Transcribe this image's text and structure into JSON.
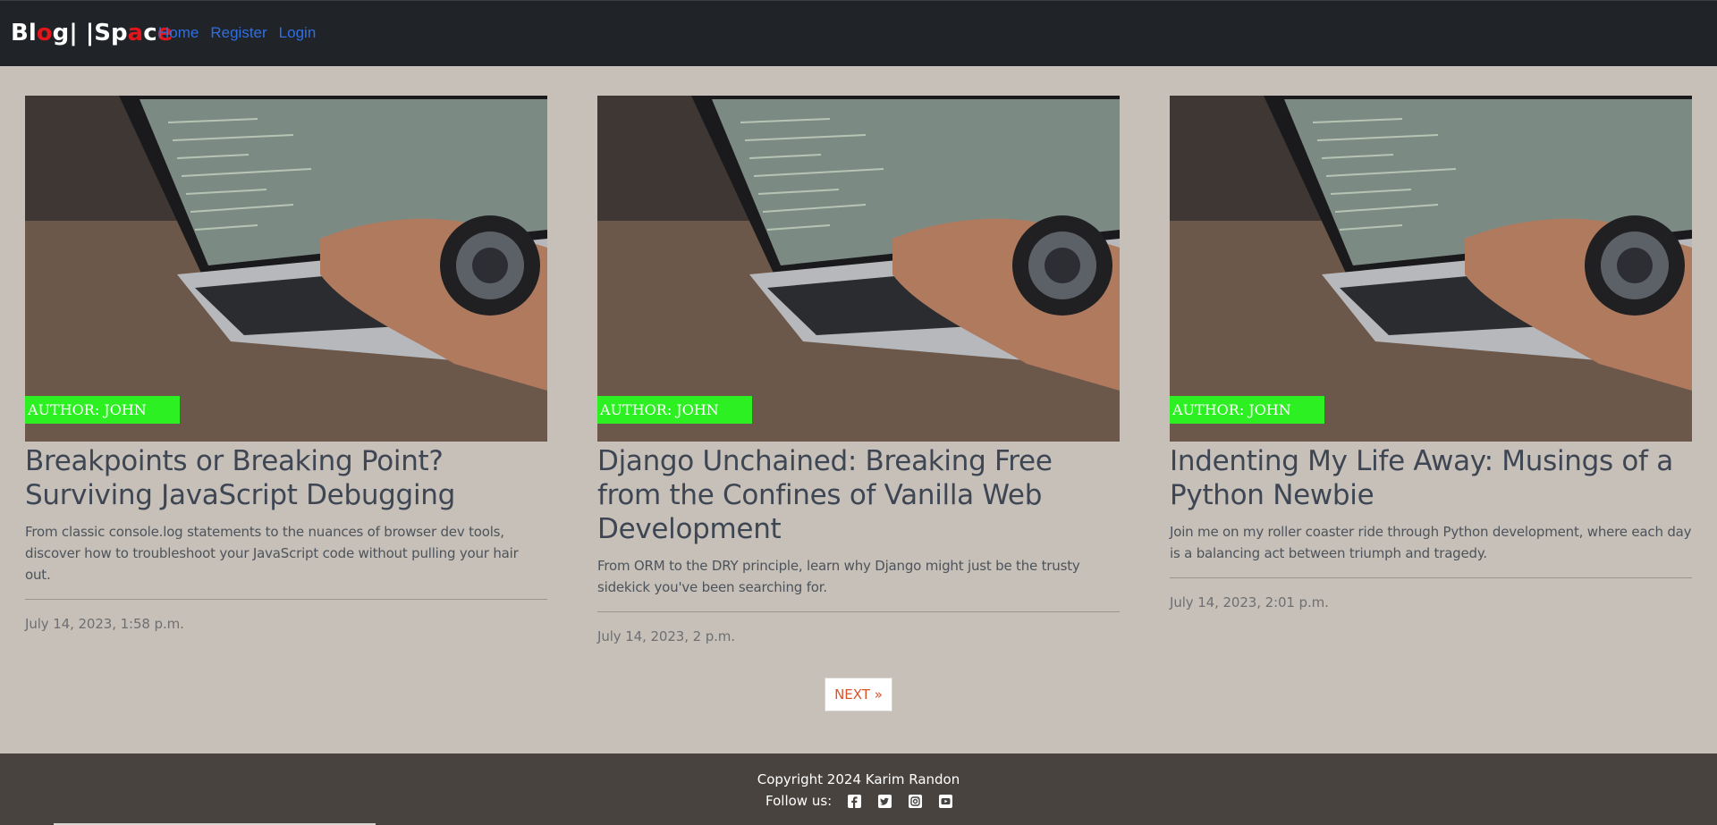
{
  "nav": {
    "brand_parts": [
      {
        "text": "Bl",
        "red": false
      },
      {
        "text": "o",
        "red": true
      },
      {
        "text": "g",
        "red": false
      },
      {
        "text": "|",
        "red": false
      },
      {
        "text": " |",
        "red": false
      },
      {
        "text": "Sp",
        "red": false
      },
      {
        "text": "a",
        "red": true
      },
      {
        "text": "c",
        "red": false
      },
      {
        "text": "e",
        "red": true
      }
    ],
    "links": [
      "Home",
      "Register",
      "Login"
    ]
  },
  "posts": [
    {
      "author": "AUTHOR: JOHN",
      "title": "Breakpoints or Breaking Point? Surviving JavaScript Debugging",
      "description": "From classic console.log statements to the nuances of browser dev tools, discover how to troubleshoot your JavaScript code without pulling your hair out.",
      "date": "July 14, 2023, 1:58 p.m."
    },
    {
      "author": "AUTHOR: JOHN",
      "title": "Django Unchained: Breaking Free from the Confines of Vanilla Web Development",
      "description": "From ORM to the DRY principle, learn why Django might just be the trusty sidekick you've been searching for.",
      "date": "July 14, 2023, 2 p.m."
    },
    {
      "author": "AUTHOR: JOHN",
      "title": "Indenting My Life Away: Musings of a Python Newbie",
      "description": "Join me on my roller coaster ride through Python development, where each day is a balancing act between triumph and tragedy.",
      "date": "July 14, 2023, 2:01 p.m."
    }
  ],
  "pagination": {
    "next_label": "NEXT »"
  },
  "footer": {
    "copyright": "Copyright 2024 Karim Randon",
    "follow_label": "Follow us:",
    "social_icons": [
      "facebook-icon",
      "twitter-icon",
      "instagram-icon",
      "youtube-icon"
    ]
  },
  "colors": {
    "navbar_bg": "#202328",
    "page_bg": "#c6c0b8",
    "nav_link": "#2f6fe0",
    "author_badge": "#2cf022",
    "next_label": "#d9532b",
    "footer_bg": "#48433f",
    "brand_red": "#e0161d"
  }
}
